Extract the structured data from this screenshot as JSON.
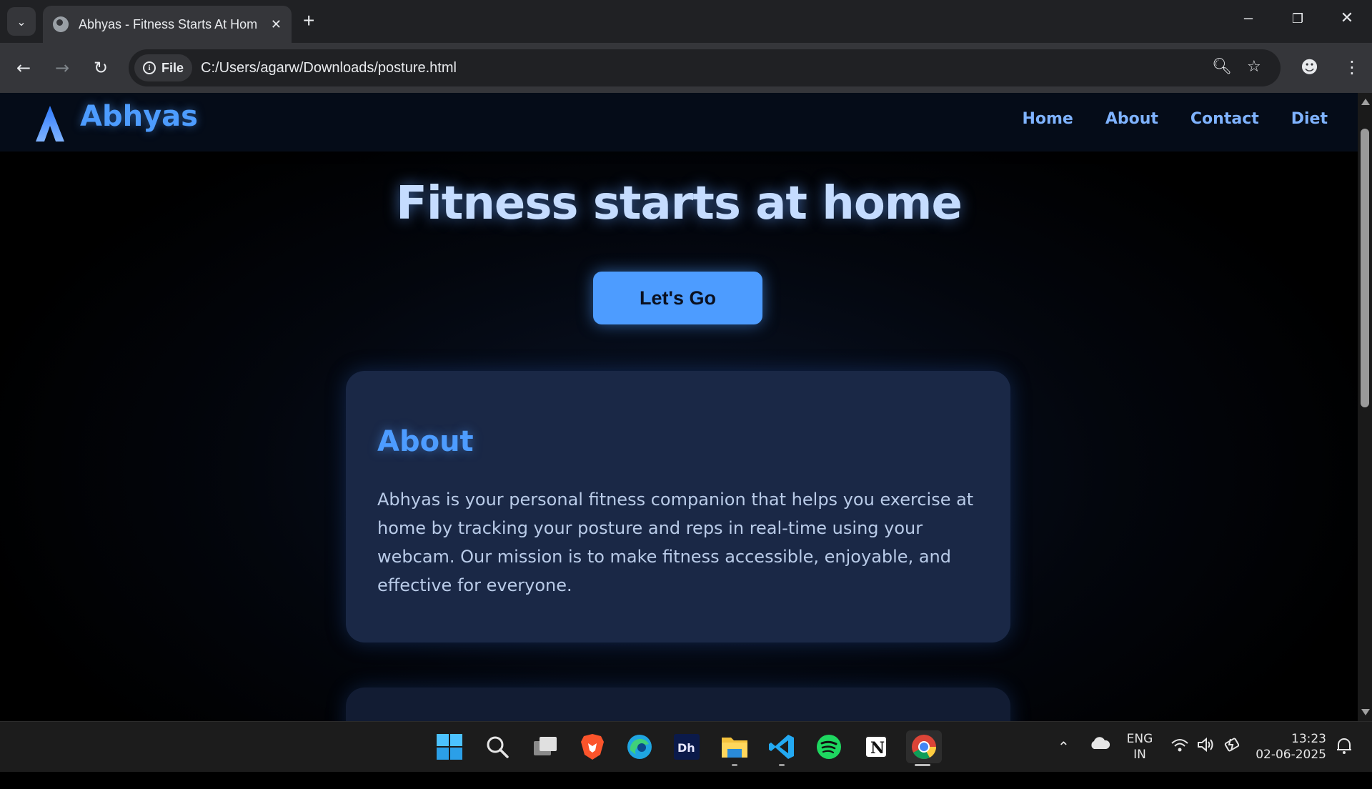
{
  "browser": {
    "tab_title": "Abhyas - Fitness Starts At Home",
    "url_chip": "File",
    "url": "C:/Users/agarw/Downloads/posture.html"
  },
  "site": {
    "brand": "Abhyas",
    "nav": [
      "Home",
      "About",
      "Contact",
      "Diet"
    ],
    "hero_title": "Fitness starts at home",
    "cta_label": "Let's Go",
    "about": {
      "title": "About",
      "body": "Abhyas is your personal fitness companion that helps you exercise at home by tracking your posture and reps in real-time using your webcam. Our mission is to make fitness accessible, enjoyable, and effective for everyone."
    }
  },
  "taskbar": {
    "language": "ENG",
    "region": "IN",
    "time": "13:23",
    "date": "02-06-2025"
  },
  "colors": {
    "accent": "#4d9cff",
    "card": "#1a2846"
  }
}
